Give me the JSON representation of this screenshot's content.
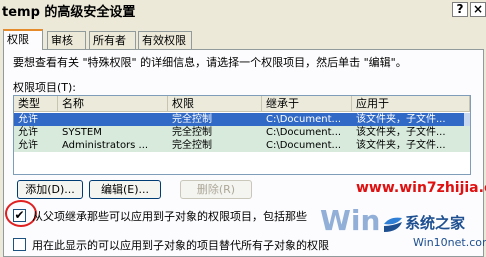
{
  "window": {
    "title": "temp 的高级安全设置",
    "help_label": "?",
    "close_label": "×"
  },
  "tabs": [
    {
      "label": "权限",
      "active": true
    },
    {
      "label": "审核",
      "active": false
    },
    {
      "label": "所有者",
      "active": false
    },
    {
      "label": "有效权限",
      "active": false
    }
  ],
  "instruction": "要想查看有关 \"特殊权限\" 的详细信息，请选择一个权限项目，然后单击 \"编辑\"。",
  "entries_label": "权限项目(T):",
  "columns": [
    "类型",
    "名称",
    "权限",
    "继承于",
    "应用于"
  ],
  "rows": [
    {
      "type": "允许",
      "name": "",
      "permission": "完全控制",
      "inherited": "C:\\Document...",
      "applies": "该文件夹，子文件..."
    },
    {
      "type": "允许",
      "name": "SYSTEM",
      "permission": "完全控制",
      "inherited": "C:\\Document...",
      "applies": "该文件夹，子文件..."
    },
    {
      "type": "允许",
      "name": "Administrators ...",
      "permission": "完全控制",
      "inherited": "C:\\Document...",
      "applies": "该文件夹，子文件..."
    }
  ],
  "buttons": {
    "add": "添加(D)...",
    "edit": "编辑(E)...",
    "remove": "删除(R)"
  },
  "checkboxes": {
    "inherit_label": "从父项继承那些可以应用到子对象的权限项目，包括那些",
    "inherit_checked": true,
    "replace_label": "用在此显示的可以应用到子对象的项目替代所有子对象的权限",
    "replace_checked": false,
    "check_mark": "✔"
  },
  "watermarks": {
    "top_url": "www.win7zhijia.cn",
    "site_name": "系统之家",
    "site_url": "Win10net.com"
  },
  "colors": {
    "selection": "#3169c6",
    "annotation_circle": "#e02020",
    "watermark_red": "#e01010",
    "tab_highlight": "#e68b2c"
  }
}
